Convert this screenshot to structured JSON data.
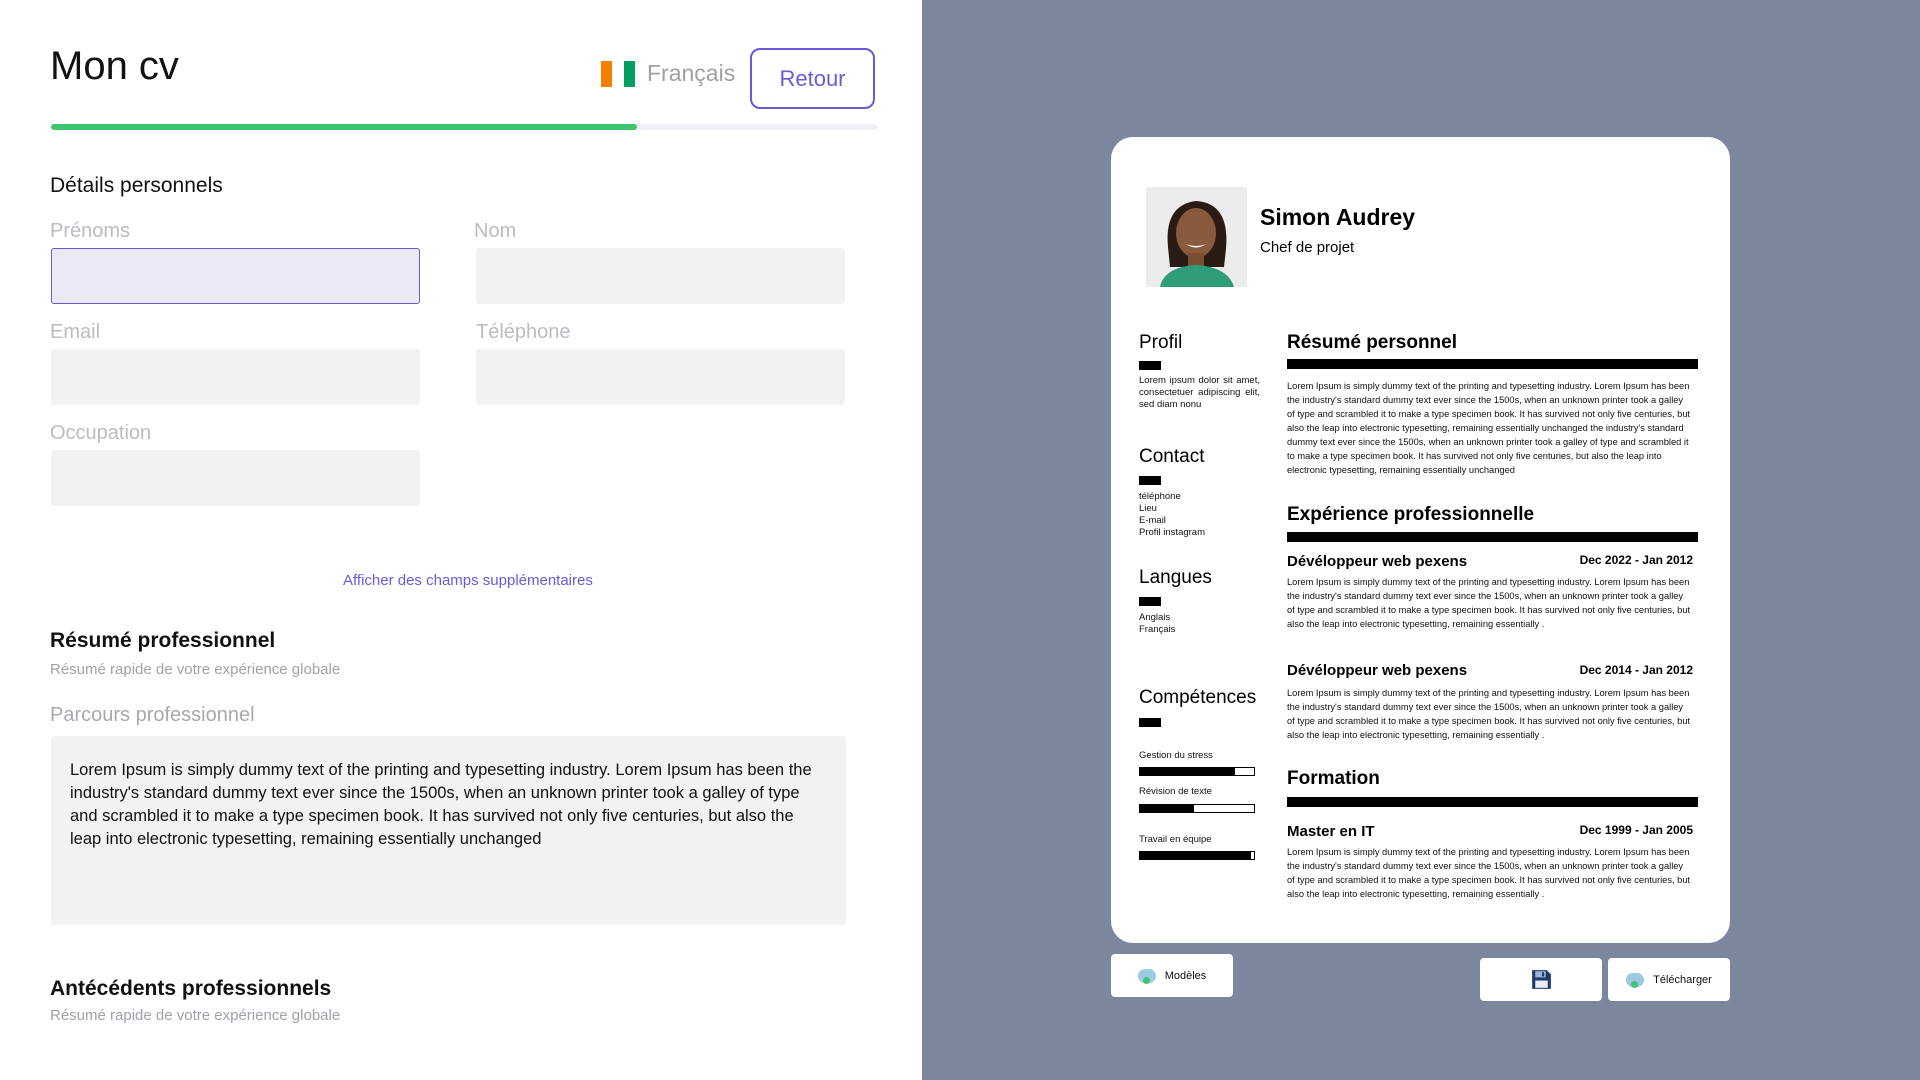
{
  "header": {
    "title": "Mon cv",
    "language": "Français",
    "back_label": "Retour"
  },
  "progress": {
    "fraction": 0.71
  },
  "flag_colors": [
    "#f77f00",
    "#ffffff",
    "#009e60"
  ],
  "personal": {
    "heading": "Détails personnels",
    "first_name_label": "Prénoms",
    "last_name_label": "Nom",
    "email_label": "Email",
    "phone_label": "Téléphone",
    "occupation_label": "Occupation",
    "first_name_value": "",
    "last_name_value": "",
    "email_value": "",
    "phone_value": "",
    "occupation_value": "",
    "more_fields_link": "Afficher des champs supplémentaires"
  },
  "summary": {
    "heading": "Résumé professionnel",
    "subtitle": "Résumé rapide de votre expérience globale",
    "field_label": "Parcours professionnel",
    "text": "Lorem Ipsum is simply dummy text of the printing and typesetting industry. Lorem Ipsum has been the industry's standard dummy text ever since the 1500s, when an unknown printer took a galley of type and scrambled it to make a type specimen book. It has survived not only five centuries, but also the leap into electronic typesetting, remaining essentially unchanged"
  },
  "history": {
    "heading": "Antécédents professionnels",
    "subtitle": "Résumé rapide de votre expérience globale"
  },
  "cv": {
    "name": "Simon Audrey",
    "role": "Chef de projet",
    "profile_heading": "Profil",
    "profile_text": "Lorem ipsum dolor sit amet, consectetuer adipiscing elit, sed diam nonu",
    "contact_heading": "Contact",
    "contact_items": [
      "téléphone",
      "Lieu",
      "E-mail",
      "Profil instagram"
    ],
    "languages_heading": "Langues",
    "languages_items": [
      "Anglais",
      "Français"
    ],
    "skills_heading": "Compétences",
    "skills": [
      {
        "name": "Gestion du stress",
        "level": 0.83
      },
      {
        "name": "Révision  de texte",
        "level": 0.47
      },
      {
        "name": "Travail en équipe",
        "level": 0.97
      }
    ],
    "summary_heading": "Résumé personnel",
    "summary_text": "Lorem Ipsum is simply dummy text of the printing and typesetting industry. Lorem Ipsum has been the industry's standard dummy text ever since the 1500s, when an unknown printer took a galley of type and scrambled it to make a type specimen book. It has survived not only five centuries, but also the leap into electronic typesetting, remaining essentially unchanged the industry's standard dummy text ever since the 1500s, when an unknown printer took a galley of type and scrambled it to make a type specimen book. It has survived not only five centuries, but also the leap into electronic typesetting, remaining essentially unchanged",
    "experience_heading": "Expérience professionnelle",
    "jobs": [
      {
        "title": "Dévéloppeur web pexens",
        "dates": "Dec 2022 - Jan 2012",
        "text": "Lorem Ipsum is simply dummy text of the printing and typesetting industry. Lorem Ipsum has been the industry's standard dummy text ever since the 1500s, when an unknown printer took a galley of type and scrambled it to make a type specimen book. It has survived not only five centuries, but also the leap into electronic typesetting, remaining essentially ."
      },
      {
        "title": "Dévéloppeur web pexens",
        "dates": "Dec 2014 - Jan 2012",
        "text": "Lorem Ipsum is simply dummy text of the printing and typesetting industry. Lorem Ipsum has been the industry's standard dummy text ever since the 1500s, when an unknown printer took a galley of type and scrambled it to make a type specimen book. It has survived not only five centuries, but also the leap into electronic typesetting, remaining essentially ."
      }
    ],
    "education_heading": "Formation",
    "education": [
      {
        "title": "Master en IT",
        "dates": "Dec 1999 - Jan 2005",
        "text": "Lorem Ipsum is simply dummy text of the printing and typesetting industry. Lorem Ipsum has been the industry's standard dummy text ever since the 1500s, when an unknown printer took a galley of type and scrambled it to make a type specimen book. It has survived not only five centuries, but also the leap into electronic typesetting, remaining essentially ."
      }
    ]
  },
  "actions": {
    "templates_label": "Modèles",
    "download_label": "Télécharger",
    "save_icon": "floppy-disk-icon"
  }
}
